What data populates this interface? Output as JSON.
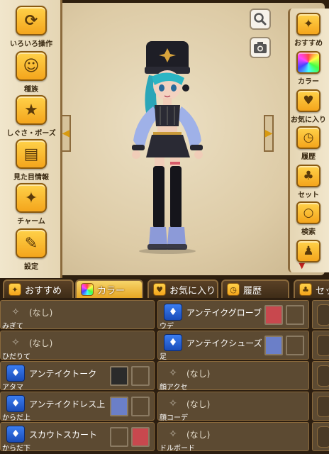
{
  "left_menu": [
    {
      "label": "いろいろ操作",
      "icon": "refresh-icon",
      "glyph": "⟳"
    },
    {
      "label": "種族",
      "icon": "people-icon",
      "glyph": "☺"
    },
    {
      "label": "しぐさ・ポーズ",
      "icon": "star-icon",
      "glyph": "★"
    },
    {
      "label": "見た目情報",
      "icon": "book-icon",
      "glyph": "▤"
    },
    {
      "label": "チャーム",
      "icon": "sparkle-icon",
      "glyph": "✦"
    },
    {
      "label": "設定",
      "icon": "wrench-icon",
      "glyph": "✎"
    }
  ],
  "right_menu": [
    {
      "label": "おすすめ",
      "icon": "sparkle-star-icon",
      "glyph": "✦"
    },
    {
      "label": "カラー",
      "icon": "rainbow-icon",
      "glyph": ""
    },
    {
      "label": "お気に入り",
      "icon": "heart-icon",
      "glyph": "♥"
    },
    {
      "label": "履歴",
      "icon": "history-icon",
      "glyph": "◷"
    },
    {
      "label": "セット",
      "icon": "shirt-icon",
      "glyph": "♣"
    },
    {
      "label": "検索",
      "icon": "magnifier-icon",
      "glyph": "○"
    },
    {
      "label": "",
      "icon": "figure-icon",
      "glyph": "♟"
    }
  ],
  "tabs": [
    {
      "label": "おすすめ",
      "icon": "sparkle-star-icon",
      "active": false
    },
    {
      "label": "カラー",
      "icon": "rainbow-icon",
      "active": true
    },
    {
      "label": "お気に入り",
      "icon": "heart-icon",
      "active": false
    },
    {
      "label": "履歴",
      "icon": "history-icon",
      "active": false
    },
    {
      "label": "セッ",
      "icon": "shirt-icon",
      "active": false
    }
  ],
  "left_column": [
    {
      "slot": "みぎて",
      "name": "(なし)",
      "equipped": false,
      "colors": []
    },
    {
      "slot": "ひだりて",
      "name": "(なし)",
      "equipped": false,
      "colors": []
    },
    {
      "slot": "アタマ",
      "name": "アンテイクトーク",
      "equipped": true,
      "colors": [
        "#2b2b2b",
        ""
      ]
    },
    {
      "slot": "からだ上",
      "name": "アンテイクドレス上",
      "equipped": true,
      "colors": [
        "#6b7fc8",
        ""
      ]
    },
    {
      "slot": "からだ下",
      "name": "スカウトスカート",
      "equipped": true,
      "colors": [
        "",
        "#c8484e"
      ]
    }
  ],
  "right_column": [
    {
      "slot": "ウデ",
      "name": "アンテイクグローブ",
      "equipped": true,
      "colors": [
        "#c8484e",
        ""
      ]
    },
    {
      "slot": "足",
      "name": "アンテイクシューズ",
      "equipped": true,
      "colors": [
        "#6b7fc8",
        ""
      ]
    },
    {
      "slot": "顔アクセ",
      "name": "(なし)",
      "equipped": false,
      "colors": []
    },
    {
      "slot": "顔コーデ",
      "name": "(なし)",
      "equipped": false,
      "colors": []
    },
    {
      "slot": "ドルボード",
      "name": "(なし)",
      "equipped": false,
      "colors": []
    }
  ],
  "colors": {
    "gold": "#f4a51c",
    "panel": "#5c4a32",
    "frame": "#8b6a3c"
  }
}
